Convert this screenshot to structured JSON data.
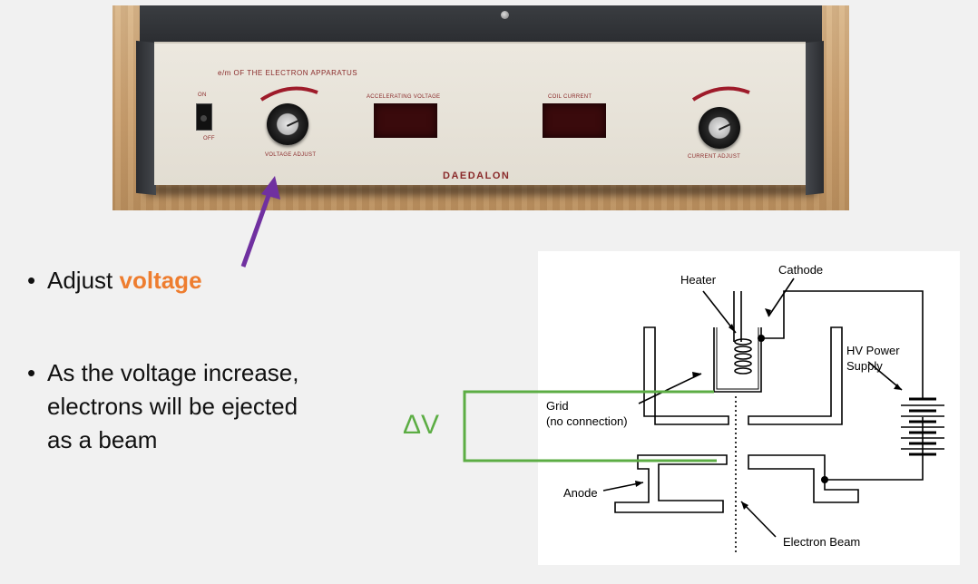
{
  "photo": {
    "panel_title": "e/m OF THE ELECTRON APPARATUS",
    "on_label": "ON",
    "off_label": "OFF",
    "accelerating_voltage_label": "ACCELERATING VOLTAGE",
    "coil_current_label": "COIL CURRENT",
    "voltage_adjust_label": "VOLTAGE ADJUST",
    "current_adjust_label": "CURRENT ADJUST",
    "brand": "DAEDALON"
  },
  "bullets": {
    "first_prefix": "Adjust ",
    "first_highlight": "voltage",
    "second_line1": "As the voltage increase,",
    "second_line2": "electrons will be ejected",
    "second_line3": "as a beam",
    "bullet_char": "•"
  },
  "delta_v_label": "ΔV",
  "diagram": {
    "heater": "Heater",
    "cathode": "Cathode",
    "hv_line1": "HV Power",
    "hv_line2": "Supply",
    "grid_line1": "Grid",
    "grid_line2": "(no connection)",
    "anode": "Anode",
    "electron_beam": "Electron Beam"
  },
  "colors": {
    "highlight": "#ee7d2f",
    "delta_v": "#5cad44",
    "arrow": "#7030a0"
  }
}
